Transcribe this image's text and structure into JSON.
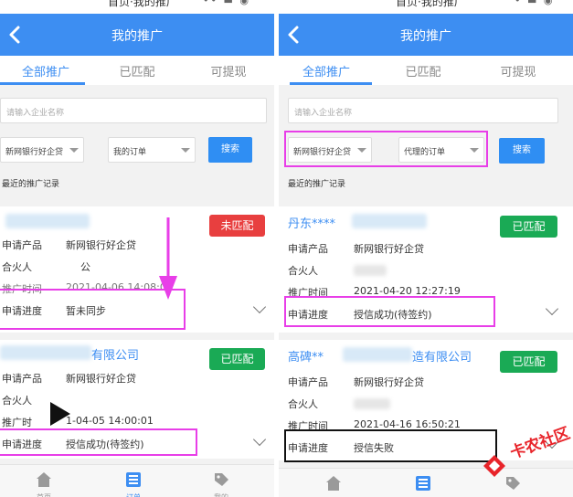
{
  "left": {
    "status_title": "首页·我的推广",
    "nav_title": "我的推广",
    "tabs": [
      "全部推广",
      "已匹配",
      "可提现"
    ],
    "search_placeholder": "请输入企业名称",
    "filter_product": "新网银行好企贷",
    "filter_order": "我的订单",
    "search_button": "搜索",
    "section_label": "最近的推广记录",
    "cards": [
      {
        "company": "",
        "badge": "未匹配",
        "rows": [
          {
            "label": "申请产品",
            "value": "新网银行好企贷"
          },
          {
            "label": "合火人",
            "value": "公"
          },
          {
            "label": "推广时间",
            "value": "2021-04-06 14:08:0"
          },
          {
            "label": "申请进度",
            "value": "暂未同步"
          }
        ]
      },
      {
        "company": "有限公司",
        "badge": "已匹配",
        "rows": [
          {
            "label": "申请产品",
            "value": "新网银行好企贷"
          },
          {
            "label": "合火人",
            "value": ""
          },
          {
            "label": "推广时",
            "value": "1-04-05 14:00:01"
          },
          {
            "label": "申请进度",
            "value": "授信成功(待签约)"
          }
        ]
      }
    ],
    "bottom_tabs": [
      "首页",
      "订单",
      "我的"
    ]
  },
  "right": {
    "status_title": "首页·我的推广",
    "nav_title": "我的推广",
    "tabs": [
      "全部推广",
      "已匹配",
      "可提现"
    ],
    "search_placeholder": "请输入企业名称",
    "filter_product": "新网银行好企贷",
    "filter_order": "代理的订单",
    "search_button": "搜索",
    "section_label": "最近的推广记录",
    "cards": [
      {
        "company": "丹东****",
        "badge": "已匹配",
        "rows": [
          {
            "label": "申请产品",
            "value": "新网银行好企贷"
          },
          {
            "label": "合火人",
            "value": ""
          },
          {
            "label": "推广时间",
            "value": "2021-04-20 12:27:19"
          },
          {
            "label": "申请进度",
            "value": "授信成功(待签约)"
          }
        ]
      },
      {
        "company": "高碑**",
        "company_suffix": "造有限公司",
        "badge": "已匹配",
        "rows": [
          {
            "label": "申请产品",
            "value": "新网银行好企贷"
          },
          {
            "label": "合火人",
            "value": ""
          },
          {
            "label": "推广时间",
            "value": "2021-04-16 16:50:21"
          },
          {
            "label": "申请进度",
            "value": "授信失败"
          }
        ]
      }
    ]
  },
  "watermark": "卡农社区",
  "colors": {
    "primary": "#3d8ef2",
    "unmatched": "#e83f3f",
    "matched": "#1aaa55",
    "annotation": "#e83ee8"
  }
}
